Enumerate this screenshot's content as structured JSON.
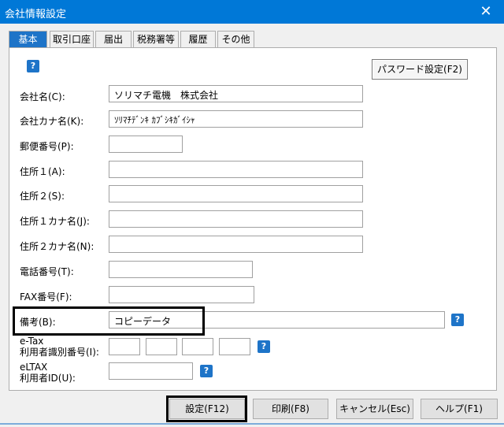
{
  "window": {
    "title": "会社情報設定",
    "close_glyph": "✕"
  },
  "tabs": [
    {
      "label": "基本"
    },
    {
      "label": "取引口座"
    },
    {
      "label": "届出"
    },
    {
      "label": "税務署等"
    },
    {
      "label": "履歴"
    },
    {
      "label": "その他"
    }
  ],
  "help_glyph": "?",
  "password_button": "パスワード設定(F2)",
  "fields": {
    "company_name": {
      "label": "会社名(C):",
      "value": "ソリマチ電機　株式会社"
    },
    "company_kana": {
      "label": "会社カナ名(K):",
      "value": "ｿﾘﾏﾁﾃﾞﾝｷ ｶﾌﾞｼｷｶﾞｲｼｬ"
    },
    "postal": {
      "label": "郵便番号(P):",
      "value": ""
    },
    "address1": {
      "label": "住所１(A):",
      "value": ""
    },
    "address2": {
      "label": "住所２(S):",
      "value": ""
    },
    "address1_kana": {
      "label": "住所１カナ名(J):",
      "value": ""
    },
    "address2_kana": {
      "label": "住所２カナ名(N):",
      "value": ""
    },
    "phone": {
      "label": "電話番号(T):",
      "value": ""
    },
    "fax": {
      "label": "FAX番号(F):",
      "value": ""
    },
    "remarks": {
      "label": "備考(B):",
      "value": "コピーデータ"
    },
    "etax": {
      "label": "e-Tax\n利用者識別番号(I):",
      "values": [
        "",
        "",
        "",
        ""
      ]
    },
    "eltax": {
      "label": "eLTAX\n利用者ID(U):",
      "value": ""
    }
  },
  "buttons": {
    "settings": "設定(F12)",
    "print": "印刷(F8)",
    "cancel": "キャンセル(Esc)",
    "help": "ヘルプ(F1)"
  }
}
